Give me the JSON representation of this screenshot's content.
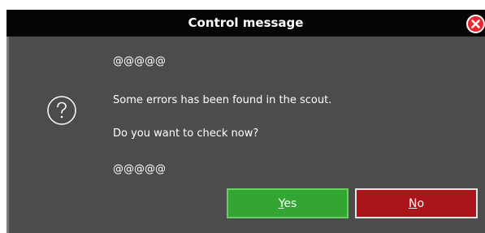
{
  "dialog": {
    "title": "Control message",
    "close_icon": "close-circle-x-icon",
    "help_icon": "question-circle-icon",
    "lines": [
      "@@@@@",
      "Some errors has been found in the scout.",
      "Do you want to check now?",
      "@@@@@"
    ],
    "buttons": {
      "yes": {
        "mnemonic": "Y",
        "rest": "es"
      },
      "no": {
        "mnemonic": "N",
        "rest": "o"
      }
    }
  },
  "colors": {
    "titlebar": "#050505",
    "body": "#4c4c4c",
    "yes_button": "#33a532",
    "no_button": "#ab1418",
    "close_icon": "#e8262c"
  }
}
